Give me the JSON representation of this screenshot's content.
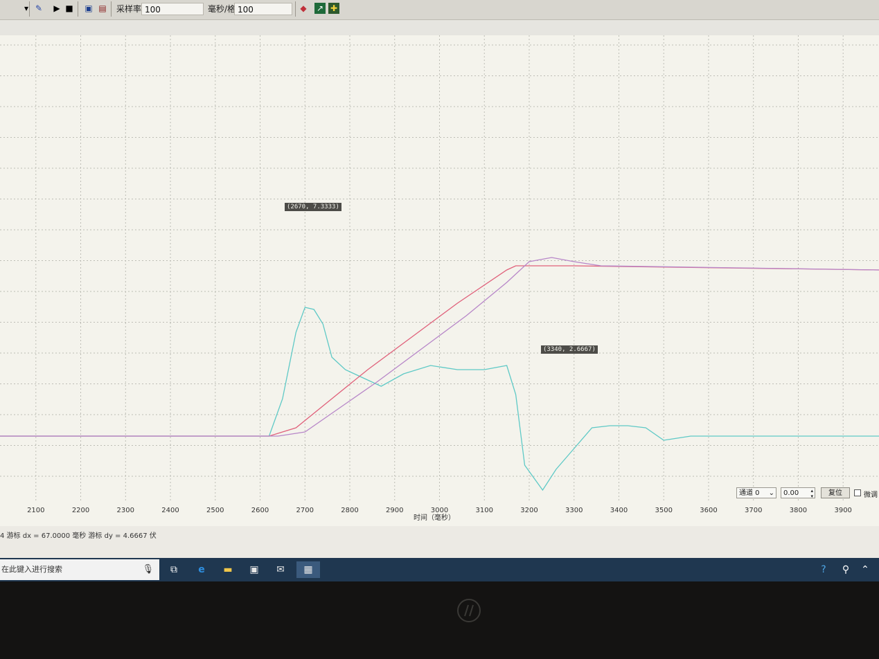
{
  "toolbar": {
    "sample_rate_label": "采样率",
    "sample_rate_value": "100",
    "ms_per_div_label": "毫秒/格",
    "ms_per_div_value": "100"
  },
  "plot": {
    "x_axis_label": "时间（毫秒）",
    "cursor_tooltips": [
      "(2670, 7.3333)",
      "(3340, 2.6667)"
    ],
    "controls": {
      "channel_label": "通道 0",
      "offset_value": "0.00",
      "reset_button": "复位",
      "fine_tune_label": "微调"
    }
  },
  "status_bar": {
    "text": "4  游标 dx = 67.0000 毫秒  游标 dy = 4.6667 伏"
  },
  "taskbar": {
    "search_placeholder": "在此键入进行搜索"
  },
  "colors": {
    "cyan": "#5ec9c6",
    "red": "#e0607a",
    "purple": "#b786c8",
    "grid": "#bdbdb5"
  },
  "chart_data": {
    "type": "line",
    "x_ticks": [
      2100,
      2200,
      2300,
      2400,
      2500,
      2600,
      2700,
      2800,
      2900,
      3000,
      3100,
      3200,
      3300,
      3400,
      3500,
      3600,
      3700,
      3800,
      3900
    ],
    "xlim": [
      2020,
      3980
    ],
    "series": [
      {
        "color": "cyan",
        "points": [
          [
            2020,
            0
          ],
          [
            2620,
            0
          ],
          [
            2650,
            0.9
          ],
          [
            2680,
            2.5
          ],
          [
            2700,
            3.1
          ],
          [
            2720,
            3.05
          ],
          [
            2740,
            2.7
          ],
          [
            2760,
            1.9
          ],
          [
            2790,
            1.6
          ],
          [
            2830,
            1.4
          ],
          [
            2870,
            1.2
          ],
          [
            2920,
            1.5
          ],
          [
            2980,
            1.7
          ],
          [
            3040,
            1.6
          ],
          [
            3100,
            1.6
          ],
          [
            3150,
            1.7
          ],
          [
            3170,
            1.0
          ],
          [
            3190,
            -0.7
          ],
          [
            3230,
            -1.3
          ],
          [
            3260,
            -0.8
          ],
          [
            3300,
            -0.3
          ],
          [
            3340,
            0.2
          ],
          [
            3380,
            0.25
          ],
          [
            3420,
            0.25
          ],
          [
            3460,
            0.2
          ],
          [
            3500,
            -0.1
          ],
          [
            3560,
            0
          ],
          [
            3980,
            0
          ]
        ]
      },
      {
        "color": "red",
        "points": [
          [
            2020,
            0
          ],
          [
            2620,
            0
          ],
          [
            2680,
            0.2
          ],
          [
            2760,
            0.9
          ],
          [
            2840,
            1.6
          ],
          [
            2940,
            2.4
          ],
          [
            3040,
            3.2
          ],
          [
            3150,
            4.0
          ],
          [
            3170,
            4.1
          ],
          [
            3300,
            4.1
          ],
          [
            3980,
            4.0
          ]
        ]
      },
      {
        "color": "purple",
        "points": [
          [
            2020,
            0
          ],
          [
            2640,
            0
          ],
          [
            2700,
            0.1
          ],
          [
            2780,
            0.7
          ],
          [
            2860,
            1.3
          ],
          [
            2960,
            2.1
          ],
          [
            3060,
            2.9
          ],
          [
            3150,
            3.7
          ],
          [
            3200,
            4.2
          ],
          [
            3250,
            4.3
          ],
          [
            3300,
            4.2
          ],
          [
            3360,
            4.1
          ],
          [
            3980,
            4.0
          ]
        ]
      }
    ]
  }
}
